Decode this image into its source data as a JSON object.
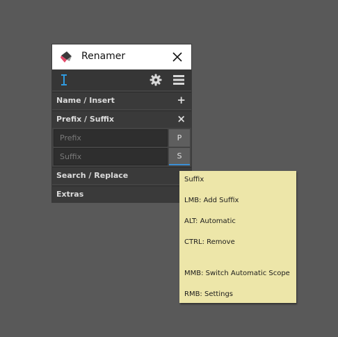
{
  "window": {
    "title": "Renamer",
    "app_icon": "renamer-logo-icon",
    "close_icon": "close-icon"
  },
  "toolbar": {
    "cursor_icon": "text-cursor-icon",
    "settings_icon": "gear-icon",
    "menu_icon": "menu-icon",
    "accent_color": "#2f9be0"
  },
  "sections": {
    "name_insert": {
      "label": "Name / Insert",
      "glyph": "+"
    },
    "prefix_suffix": {
      "label": "Prefix / Suffix",
      "glyph": "×"
    },
    "search_replace": {
      "label": "Search / Replace"
    },
    "extras": {
      "label": "Extras"
    }
  },
  "prefix": {
    "placeholder": "Prefix",
    "button_label": "P"
  },
  "suffix": {
    "placeholder": "Suffix",
    "button_label": "S"
  },
  "tooltip": {
    "title": "Suffix",
    "lines": [
      "LMB: Add Suffix",
      "ALT: Automatic",
      "CTRL: Remove",
      "MMB: Switch Automatic Scope",
      "RMB: Settings"
    ]
  }
}
